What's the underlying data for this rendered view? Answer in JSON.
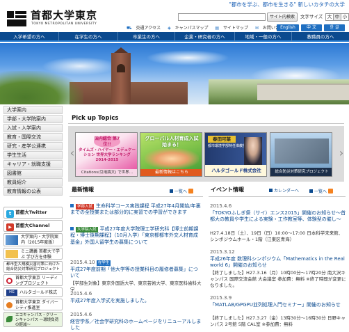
{
  "header": {
    "tagline": "\"都市を学ぶ、都市を生きる\" 新しいカタチの大学",
    "univ_name": "首都大学東京",
    "univ_sub": "TOKYO METROPOLITAN UNIVERSITY",
    "search_button": "サイト内検索",
    "fontsize_label": "文字サイズ",
    "fontsize_options": [
      "大",
      "中",
      "小"
    ],
    "utility_links": [
      "交通アクセス",
      "キャンパスマップ",
      "サイトマップ",
      "お問い合せ一覧"
    ],
    "lang_options": [
      "English",
      "中 文",
      "한 글"
    ]
  },
  "nav": [
    "入学希望の方へ",
    "在学生の方へ",
    "卒業生の方へ",
    "企業・研究者の方へ",
    "地域・一般の方へ",
    "教職員の方へ"
  ],
  "sidebar": {
    "items": [
      "大学案内",
      "学部・大学院案内",
      "入試・入学案内",
      "教育・国際交流",
      "研究・産学公連携",
      "学生生活",
      "キャリア・就職支援",
      "図書館",
      "教員紹介",
      "教育情報の公表"
    ],
    "banners": [
      "首都大Twitter",
      "首都大Channel",
      "大学案内・大学院案内（2015年度版）",
      "ミニ講義 首都大で学ぶ 学び方を体験",
      "都市型大規模災害対策に向けた 総合防災対策研究プロジェクト",
      "首都大学東京 リーディングプロジェクト",
      "ハルタゴールド株式会社",
      "首都大学東京 ダイバーシティ推進室",
      "エコキャンパス・グリーンキャンパス 〜環境負荷の軽減〜"
    ]
  },
  "pickup": {
    "title": "Pick up Topics",
    "cards": [
      {
        "label": "国内総合 第7位!!",
        "sub": "タイムズ・ハイヤー・エデュケーション 世界大学ランキング 2014-2015",
        "footer": "Citations(引用論文) で世界…"
      },
      {
        "label": "グローバル人材育成入試 始まる！",
        "sub": "",
        "footer": "最新情報はこちら"
      },
      {
        "label": "春田可菜",
        "sub": "都市環境学部特任准教授",
        "footer": "ハルタゴールド株式会社"
      },
      {
        "label": "総合防災対策研究プロジェクト",
        "sub": "",
        "footer": "総合防災対策研究プロジェクト"
      }
    ]
  },
  "news": {
    "title": "最新情報",
    "more": "一覧へ",
    "items": [
      {
        "date": "",
        "tag": "学部入試",
        "text": "生命科学コース実践課程 平成27年4月開始/年裏までの全授業または部分的に実習での学習ができます"
      },
      {
        "date": "",
        "tag": "大学院入試",
        "text": "平成27年度大学院理工学研究科【博士前期課程・博士後期課程】（10月入学）「東京都都市外交人材育成基金」外国人留学生の募集について"
      },
      {
        "date": "2015.4.10",
        "tag": "在学生",
        "text": "平成27年度前期「他大学等の授業科目の履修者募集」について"
      },
      {
        "date": "",
        "tag": "",
        "text": "【学部生対象】東京外国語大学、東京芸術大学、東京医科歯科大学"
      },
      {
        "date": "2015.4.6",
        "tag": "",
        "text": "平成27年度入学式を実施しました。"
      },
      {
        "date": "2015.4.6",
        "tag": "",
        "text": "経営学系／社会学研究科のホームページをリニューアルしました"
      }
    ]
  },
  "events": {
    "title": "イベント情報",
    "calendar": "カレンダーへ",
    "more": "一覧へ",
    "items": [
      {
        "date": "2015.4.6",
        "title": "「TOKYOふしぎ祭（サイ）エンス2015」開催のお知らせ～首都大の教員や学生による実験・工作教室等、体験型の催し～",
        "body": "H27.4.18日（土）、19日（日）10:00～17:00 日本科学未来館、シンポジウムホール・1階（江東区青海）"
      },
      {
        "date": "2015.3.12",
        "title": "平成26年度 数理科シンポジウム「Mathematics in the Real world 6」開催のお知らせ",
        "body": "【終了しました】H27.3.16（月）10時00分～17時20分 南大沢キャンパス 国際交流会館 大会議室 参加費：無料 ※終了時間が変更になりました。"
      },
      {
        "date": "2015.3.9",
        "title": "「MATLAB/GPGPU並列処理入門セミナー」開催のお知らせ",
        "body": "【終了しました】H27.3.27（金）13時30分～16時30分 日野キャンパス 2号館 5階 CAL室 ※参加費：無料"
      }
    ]
  },
  "colors": {
    "nav": "#0b4a8f",
    "accent": "#1f6fc1",
    "tag_red": "#d23a2a",
    "tag_green": "#3a8a3a",
    "tag_blue": "#1f6fc1"
  }
}
